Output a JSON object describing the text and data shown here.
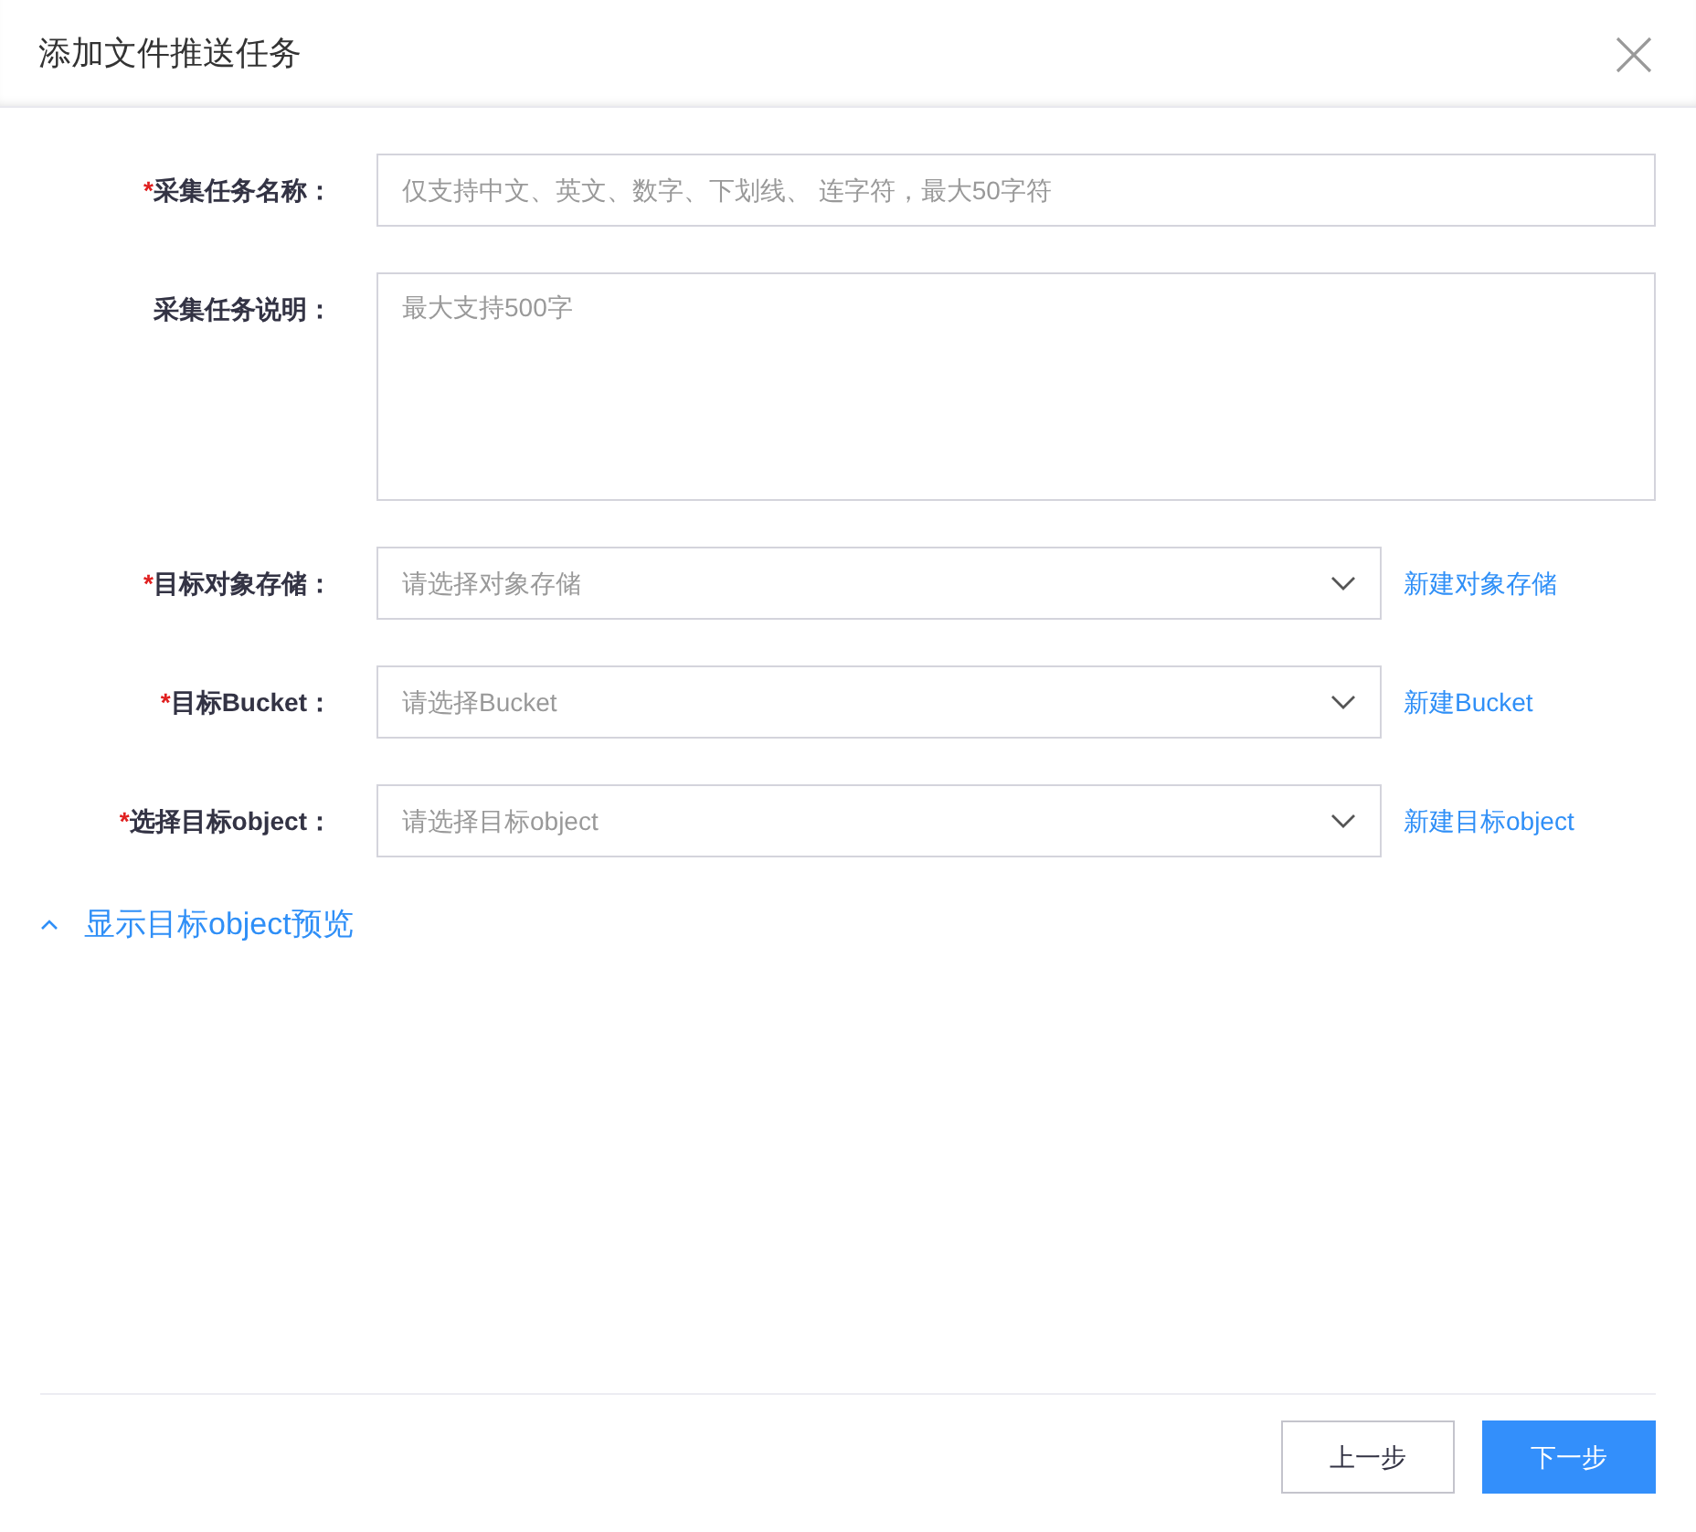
{
  "dialog": {
    "title": "添加文件推送任务"
  },
  "required_mark": "*",
  "fields": [
    {
      "kind": "text",
      "label": "采集任务名称：",
      "required": true,
      "placeholder": "仅支持中文、英文、数字、下划线、 连字符，最大50字符"
    },
    {
      "kind": "textarea",
      "label": "采集任务说明：",
      "required": false,
      "placeholder": "最大支持500字"
    },
    {
      "kind": "select",
      "label": "目标对象存储：",
      "required": true,
      "placeholder": "请选择对象存储",
      "link": "新建对象存储"
    },
    {
      "kind": "select",
      "label": "目标Bucket：",
      "required": true,
      "placeholder": "请选择Bucket",
      "link": "新建Bucket"
    },
    {
      "kind": "select",
      "label": "选择目标object：",
      "required": true,
      "placeholder": "请选择目标object",
      "link": "新建目标object"
    }
  ],
  "preview_toggle": {
    "label": "显示目标object预览",
    "expanded": true
  },
  "buttons": [
    {
      "label": "上一步",
      "primary": false
    },
    {
      "label": "下一步",
      "primary": true
    }
  ]
}
